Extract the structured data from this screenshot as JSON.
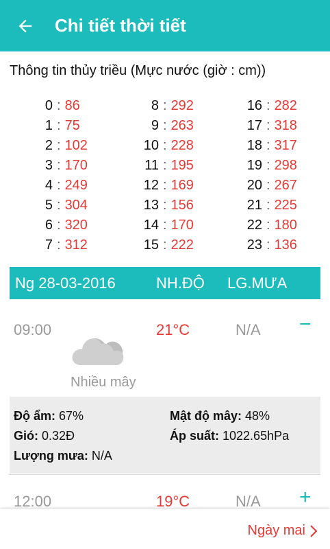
{
  "header": {
    "title": "Chi tiết thời tiết",
    "back_icon": "arrow-left-icon"
  },
  "tide": {
    "title": "Thông tin thủy triều (Mực nước (giờ : cm))",
    "separator": ":",
    "columns": [
      [
        {
          "h": "0",
          "v": "86"
        },
        {
          "h": "1",
          "v": "75"
        },
        {
          "h": "2",
          "v": "102"
        },
        {
          "h": "3",
          "v": "170"
        },
        {
          "h": "4",
          "v": "249"
        },
        {
          "h": "5",
          "v": "304"
        },
        {
          "h": "6",
          "v": "320"
        },
        {
          "h": "7",
          "v": "312"
        }
      ],
      [
        {
          "h": "8",
          "v": "292"
        },
        {
          "h": "9",
          "v": "263"
        },
        {
          "h": "10",
          "v": "228"
        },
        {
          "h": "11",
          "v": "195"
        },
        {
          "h": "12",
          "v": "169"
        },
        {
          "h": "13",
          "v": "156"
        },
        {
          "h": "14",
          "v": "170"
        },
        {
          "h": "15",
          "v": "222"
        }
      ],
      [
        {
          "h": "16",
          "v": "282"
        },
        {
          "h": "17",
          "v": "318"
        },
        {
          "h": "18",
          "v": "317"
        },
        {
          "h": "19",
          "v": "298"
        },
        {
          "h": "20",
          "v": "267"
        },
        {
          "h": "21",
          "v": "225"
        },
        {
          "h": "22",
          "v": "180"
        },
        {
          "h": "23",
          "v": "136"
        }
      ]
    ]
  },
  "table_header": {
    "date": "Ng 28-03-2016",
    "temp": "NH.ĐỘ",
    "rain": "LG.MƯA"
  },
  "entries": [
    {
      "time": "09:00",
      "temp": "21°C",
      "rain": "N/A",
      "desc": "Nhiều mây",
      "toggle": "−",
      "icon": "cloud-icon"
    },
    {
      "time": "12:00",
      "temp": "19°C",
      "rain": "N/A",
      "toggle": "+",
      "icon": "cloud-icon"
    }
  ],
  "details": {
    "humidity_label": "Độ ẩm:",
    "humidity": "67%",
    "cloud_label": "Mật độ mây:",
    "cloud": "48%",
    "wind_label": "Gió:",
    "wind": "0.32Đ",
    "pressure_label": "Áp suất:",
    "pressure": "1022.65hPa",
    "rain_label": "Lượng mưa:",
    "rain": "N/A"
  },
  "footer": {
    "next_label": "Ngày mai",
    "next_icon": "chevron-right-icon"
  },
  "colors": {
    "accent": "#1cbcbc",
    "value_red": "#e53935"
  }
}
